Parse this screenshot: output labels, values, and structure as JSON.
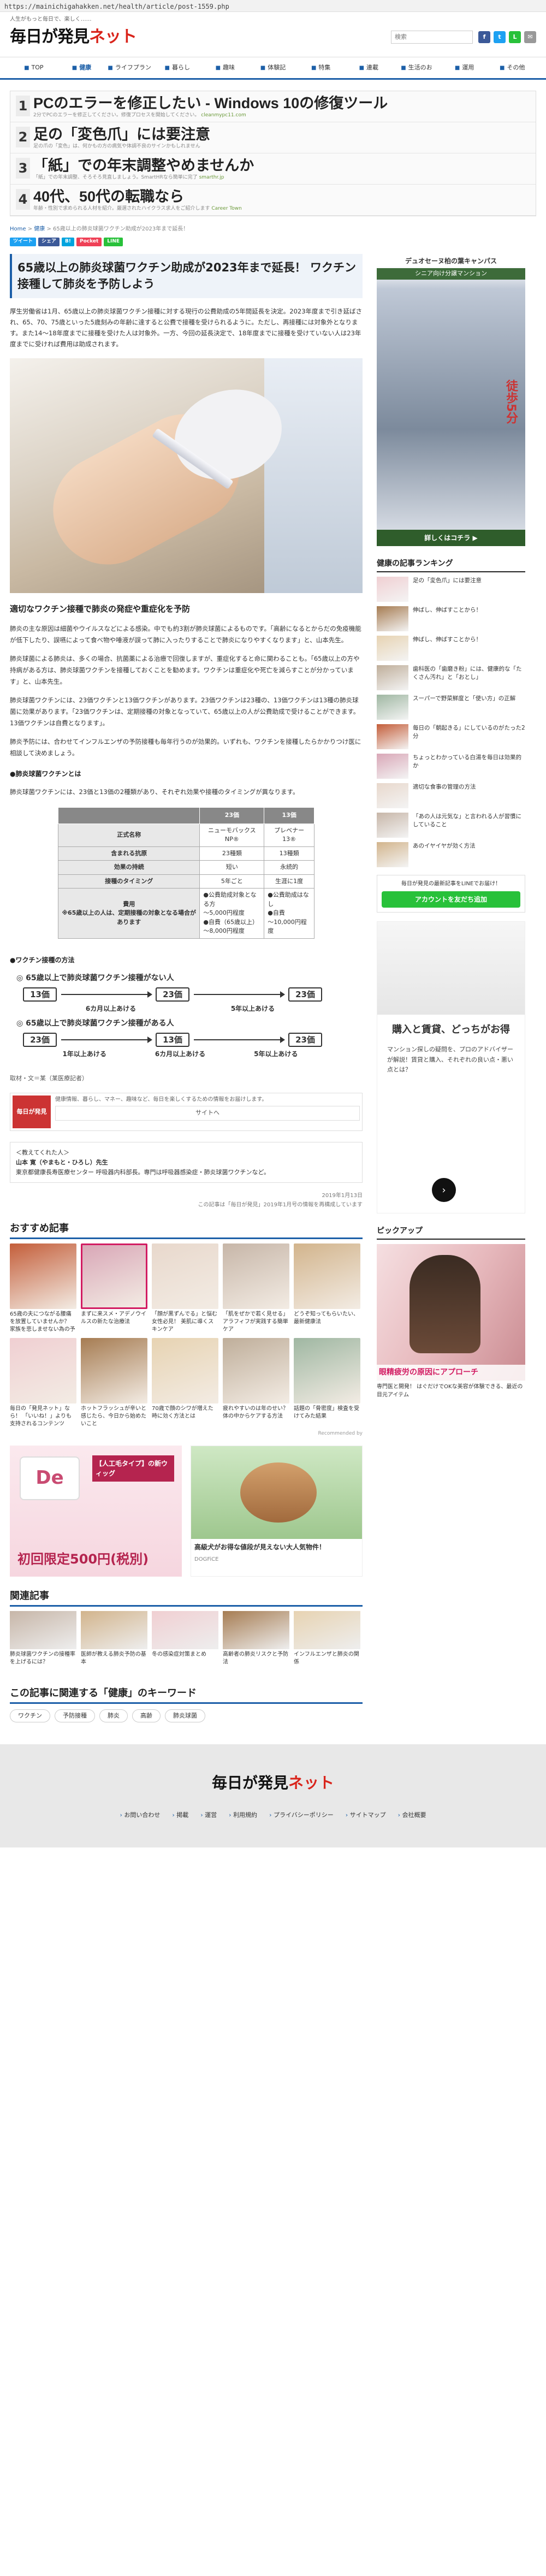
{
  "browser": {
    "url": "https://mainichigahakken.net/health/article/post-1559.php"
  },
  "header": {
    "tagline": "人生がもっと毎日で、楽しく……",
    "logo_main": "毎日が発見",
    "logo_net": "ネット",
    "search_placeholder": "検索"
  },
  "header_icons": [
    {
      "label": "f",
      "color": "#3b5998"
    },
    {
      "label": "t",
      "color": "#1da1f2"
    },
    {
      "label": "L",
      "color": "#28c13a"
    },
    {
      "label": "✉",
      "color": "#999999"
    }
  ],
  "nav": [
    {
      "label": "TOP",
      "icon": "home-icon",
      "active": false
    },
    {
      "label": "健康",
      "icon": "heart-icon",
      "active": true
    },
    {
      "label": "ライフプラン",
      "icon": "clipboard-icon",
      "active": false
    },
    {
      "label": "暮らし",
      "icon": "house-icon",
      "active": false
    },
    {
      "label": "趣味",
      "icon": "palette-icon",
      "active": false
    },
    {
      "label": "体験記",
      "icon": "pen-icon",
      "active": false
    },
    {
      "label": "特集",
      "icon": "star-icon",
      "active": false
    },
    {
      "label": "連載",
      "icon": "book-icon",
      "active": false
    },
    {
      "label": "生活のお",
      "icon": "info-icon",
      "active": false
    },
    {
      "label": "運用",
      "icon": "chart-icon",
      "active": false
    },
    {
      "label": "その他",
      "icon": "more-icon",
      "active": false
    }
  ],
  "top_ads": [
    {
      "num": "1",
      "title": "PCのエラーを修正したい - Windows 10の修復ツール",
      "sub": "2分でPCのエラーを修正してください。修復プロセスを開始してください。",
      "url": "cleanmypc11.com"
    },
    {
      "num": "2",
      "title": "足の「変色爪」には要注意",
      "sub": "足の爪の「変色」は、何かもの方の病気や体調不良のサインかもしれません",
      "url": ""
    },
    {
      "num": "3",
      "title": "「紙」での年末調整やめませんか",
      "sub": "「紙」での年末調整、そろそろ見直しましょう。SmartHRなら簡単に完了",
      "url": "smarthr.jp"
    },
    {
      "num": "4",
      "title": "40代、50代の転職なら",
      "sub": "年齢・性別で求められる人材を紹介。厳選されたハイクラス求人をご紹介します",
      "url": "Career Town"
    }
  ],
  "breadcrumb": {
    "home": "Home",
    "sep": " > ",
    "section": "健康",
    "current": "65歳以上の肺炎球菌ワクチン助成が2023年まで延長！"
  },
  "social": [
    {
      "label": "ツイート",
      "color": "#1da1f2"
    },
    {
      "label": "シェア",
      "color": "#3b5998"
    },
    {
      "label": "B!",
      "color": "#00a4de"
    },
    {
      "label": "Pocket",
      "color": "#ef4056"
    },
    {
      "label": "LINE",
      "color": "#28c13a"
    }
  ],
  "article": {
    "title": "65歳以上の肺炎球菌ワクチン助成が2023年まで延長！ ワクチン接種して肺炎を予防しよう",
    "lead": "厚生労働省は1月、65歳以上の肺炎球菌ワクチン接種に対する現行の公費助成の5年間延長を決定。2023年度まで引き延ばされ、65、70、75歳といった5歳刻みの年齢に達すると公費で接種を受けられるように。ただし、再接種には対象外となります。また14～18年度までに接種を受けた人は対象外。一方、今回の延長決定で、18年度までに接種を受けていない人は23年度までに受ければ費用は助成されます。",
    "subheading": "適切なワクチン接種で肺炎の発症や重症化を予防",
    "paragraphs": [
      "肺炎の主な原因は細菌やウイルスなどによる感染。中でも約3割が肺炎球菌によるものです。「高齢になるとからだの免疫機能が低下したり、誤嚥によって食べ物や唾液が誤って肺に入ったりすることで肺炎になりやすくなります」と、山本先生。",
      "肺炎球菌による肺炎は、多くの場合、抗菌薬による治療で回復しますが、重症化すると命に関わることも。「65歳以上の方や持病がある方は、肺炎球菌ワクチンを接種しておくことを勧めます。ワクチンは重症化や死亡を減らすことが分かっています」と、山本先生。",
      "肺炎球菌ワクチンには、23価ワクチンと13価ワクチンがあります。23価ワクチンは23種の、13価ワクチンは13種の肺炎球菌に効果があります。「23価ワクチンは、定期接種の対象となっていて、65歳以上の人が公費助成で受けることができます。13価ワクチンは自費となります」。",
      "肺炎予防には、合わせてインフルエンザの予防接種も毎年行うのが効果的。いずれも、ワクチンを接種したらかかりつけ医に相談して決めましょう。"
    ],
    "bullet1": "●肺炎球菌ワクチンとは",
    "bullet1_text": "肺炎球菌ワクチンには、23価と13価の2種類があり、それぞれ効果や接種のタイミングが異なります。",
    "table": {
      "headers": [
        "",
        "23価",
        "13価"
      ],
      "rows": [
        [
          "正式名称",
          "ニューモバックスNP®",
          "プレベナー13®"
        ],
        [
          "含まれる抗原",
          "23種類",
          "13種類"
        ],
        [
          "効果の持続",
          "短い",
          "永続的"
        ],
        [
          "接種のタイミング",
          "5年ごと",
          "生涯に1度"
        ],
        [
          "費用\n※65歳以上の人は、定期接種の対象となる場合があります",
          "●公費助成対象となる方\n～5,000円程度\n●自費（65歳以上）\n～8,000円程度",
          "●公費助成はなし\n●自費\n～10,000円程度"
        ]
      ]
    },
    "bullet2": "●ワクチン接種の方法",
    "schedules": [
      {
        "title": "◎ 65歳以上で肺炎球菌ワクチン接種がない人",
        "boxes": [
          "13価",
          "23価",
          "23価"
        ],
        "notes": [
          "6カ月以上あける",
          "5年以上あける"
        ]
      },
      {
        "title": "◎ 65歳以上で肺炎球菌ワクチン接種がある人",
        "boxes": [
          "23価",
          "13価",
          "23価"
        ],
        "notes": [
          "1年以上あける",
          "6カ月以上あける",
          "5年以上あける"
        ]
      }
    ],
    "credit": "取材・文＝某（某医療記者）",
    "profile_head": "＜教えてくれた人＞",
    "profile_name": "山本 寛（やまもと・ひろし）先生",
    "profile_body": "東京都健康長寿医療センター 呼吸器内科部長。専門は呼吸器感染症・肺炎球菌ワクチンなど。",
    "date": "2019年1月13日",
    "source": "この記事は「毎日が発見」2019年1月号の情報を再構成しています"
  },
  "banner": {
    "img": "毎日が発見",
    "text": "健康情報、暮らし、マネー、趣味など、毎日を楽しくするための情報をお届けします。",
    "button": "サイトへ"
  },
  "recommend": {
    "heading": "おすすめ記事",
    "powered": "Recommended by",
    "items": [
      "65歳の夫につながる腰痛を放置していませんか？ 家族を悲しませない為の予防法",
      "まずに来スメ・アデノウイルスの新たな治療法",
      "「顔が黒ずんでる」と悩む女性必見！ 美肌に導くスキンケア",
      "「肌をぜかで若く見せる」アラフィフが実践する簡単ケア",
      "どうぞ知ってもらいたい、最新健康法",
      "毎日の「発見ネット」なら！ 「いいね！」よりも支持されるコンテンツ",
      "ホットフラッシュが辛いと感じたら、今日から始めたいこと",
      "70歳で顔のシワが増えた時に効く方法とは",
      "疲れやすいのは年のせい？ 体の中からケアする方法",
      "話題の「骨密度」検査を受けてみた結果"
    ]
  },
  "ads_pair": [
    {
      "title": "【人工毛タイプ】の新ウィッグ",
      "sub": "初回限定500円(税別)",
      "brand": "De"
    },
    {
      "title": "高級犬がお得な値段が見えない大人気物件！",
      "sub": "DOGFiCE"
    }
  ],
  "related": {
    "heading": "関連記事",
    "items": [
      "肺炎球菌ワクチンの接種率を上げるには？",
      "医師が教える肺炎予防の基本",
      "冬の感染症対策まとめ",
      "高齢者の肺炎リスクと予防法",
      "インフルエンザと肺炎の関係"
    ]
  },
  "keywords": {
    "heading": "この記事に関連する「健康」のキーワード",
    "items": [
      "ワクチン",
      "予防接種",
      "肺炎",
      "高齢",
      "肺炎球菌"
    ]
  },
  "sidebar": {
    "ad_text": "デュオセーヌ柏の葉キャンパス",
    "ad_sub": "シニア向け分譲マンション",
    "ad_station": "徒歩5分",
    "ad_detail": "詳しくはコチラ ▶",
    "ranking_title": "健康の記事ランキング",
    "ranking": [
      "足の「変色爪」には要注意",
      "伸ばし、伸ばすことから！",
      "伸ばし、伸ばすことから！",
      "歯科医の「歯磨き粉」には、健康的な「たくさん汚れ」と「おとし」",
      "スーパーで野菜鮮度と「使い方」の正解",
      "毎日の「朝起きる」にしているのがたった2分",
      "ちょっとわかっている白湯を毎日は効果的か",
      "適切な食事の管理の方法",
      "「あの人は元気な」と言われる人が習慣にしていること",
      "あのイヤイヤが効く方法"
    ],
    "line_head": "毎日が発見の最新記事をLINEでお届け！",
    "line_btn": "アカウントを友だち追加",
    "suumo_head": "購入と賃貸、どっちがお得",
    "suumo_text": "マンション探しの疑問を、プロのアドバイザーが解説！賃貸と購入、それぞれの良い点・悪い点とは？",
    "pickup_title": "ピックアップ",
    "pickup_text": "眼精疲労の原因にアプローチ",
    "pickup_sub": "専門医と開発！ はぐだけでOKな美容が体験できる、最近の目元アイテム"
  },
  "footer": {
    "logo_main": "毎日が発見",
    "logo_net": "ネット",
    "links": [
      "お問い合わせ",
      "掲載",
      "運営",
      "利用規約",
      "プライバシーポリシー",
      "サイトマップ",
      "会社概要"
    ]
  }
}
